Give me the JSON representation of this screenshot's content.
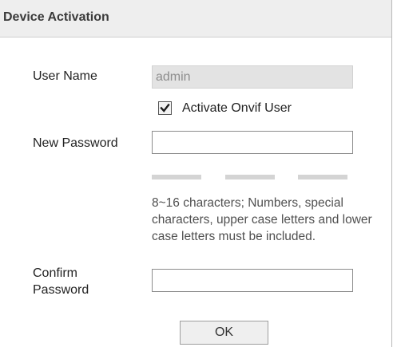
{
  "dialog": {
    "title": "Device Activation"
  },
  "form": {
    "user_name_label": "User Name",
    "user_name_value": "admin",
    "activate_onvif_label": "Activate Onvif User",
    "activate_onvif_checked": true,
    "new_password_label": "New Password",
    "new_password_value": "",
    "password_hint": "8~16 characters; Numbers, special characters, upper case letters and lower case letters must be included.",
    "confirm_password_label": "Confirm\nPassword",
    "confirm_password_value": ""
  },
  "strength_meter": {
    "segments": 3,
    "segment_color": "#d4d4d4"
  },
  "actions": {
    "ok_label": "OK"
  },
  "icons": {
    "checkbox_mark": "check-icon"
  }
}
